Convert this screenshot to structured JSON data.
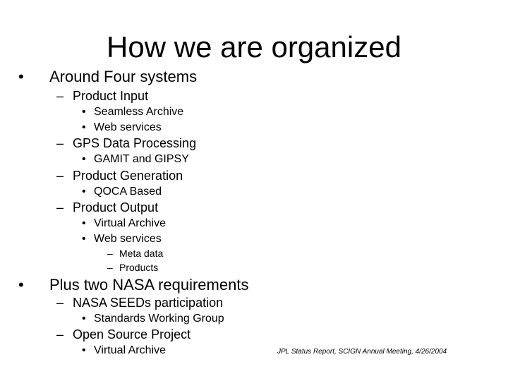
{
  "slide": {
    "title": "How we are organized",
    "markers": {
      "bullet": "•",
      "dash": "–"
    },
    "sections": [
      {
        "label": "Around Four systems",
        "items": [
          {
            "label": "Product Input",
            "items": [
              {
                "label": "Seamless Archive"
              },
              {
                "label": "Web services"
              }
            ]
          },
          {
            "label": "GPS Data Processing",
            "items": [
              {
                "label": "GAMIT and GIPSY"
              }
            ]
          },
          {
            "label": "Product Generation",
            "items": [
              {
                "label": "QOCA Based"
              }
            ]
          },
          {
            "label": "Product Output",
            "items": [
              {
                "label": "Virtual Archive"
              },
              {
                "label": "Web services",
                "items": [
                  {
                    "label": "Meta data"
                  },
                  {
                    "label": "Products"
                  }
                ]
              }
            ]
          }
        ]
      },
      {
        "label": "Plus two NASA requirements",
        "items": [
          {
            "label": "NASA SEEDs participation",
            "items": [
              {
                "label": "Standards Working Group"
              }
            ]
          },
          {
            "label": "Open Source Project",
            "items": [
              {
                "label": "Virtual Archive"
              }
            ]
          }
        ]
      }
    ],
    "footer": "JPL Status Report, SCIGN  Annual Meeting, 4/26/2004"
  }
}
